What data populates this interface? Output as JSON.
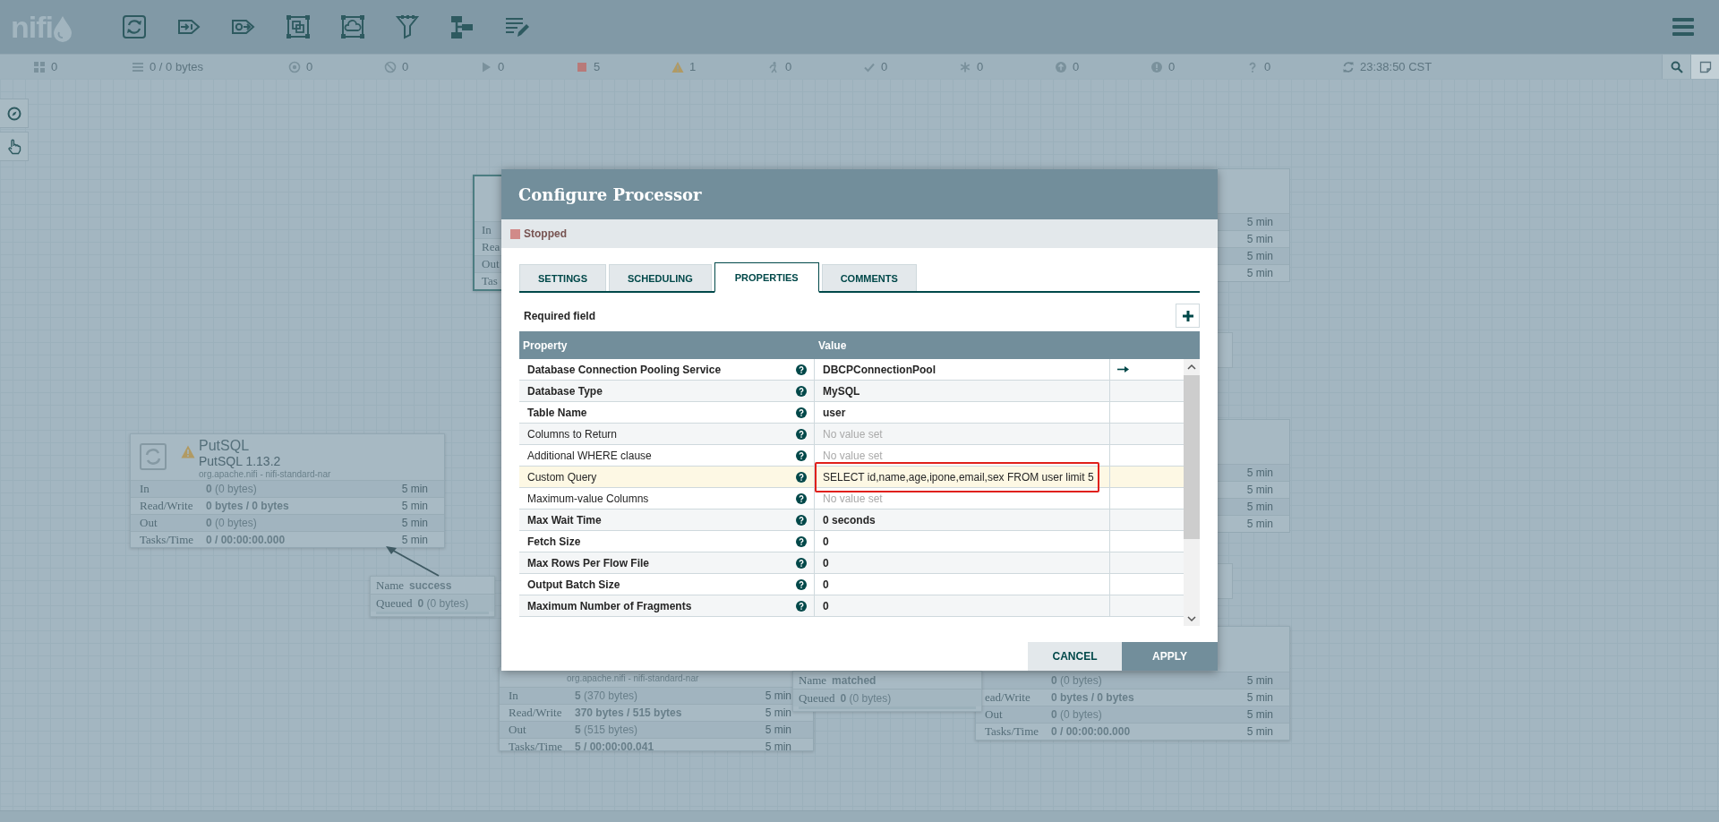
{
  "toolbar": {
    "logo": "nifi"
  },
  "status_bar": {
    "items": [
      {
        "kind": "cluster",
        "count": "0"
      },
      {
        "kind": "queued",
        "count": "0 / 0 bytes"
      },
      {
        "kind": "transmitting",
        "count": "0"
      },
      {
        "kind": "not-transmitting",
        "count": "0"
      },
      {
        "kind": "running",
        "count": "0"
      },
      {
        "kind": "stopped",
        "count": "5"
      },
      {
        "kind": "invalid",
        "count": "1"
      },
      {
        "kind": "disabled",
        "count": "0"
      },
      {
        "kind": "up-to-date",
        "count": "0"
      },
      {
        "kind": "locally-modified",
        "count": "0"
      },
      {
        "kind": "stale",
        "count": "0"
      },
      {
        "kind": "modified-stale",
        "count": "0"
      },
      {
        "kind": "sync-failure",
        "count": "0"
      }
    ],
    "refreshed": "23:38:50 CST"
  },
  "canvas": {
    "processors": [
      {
        "name": "PutSQL",
        "type": "PutSQL 1.13.2",
        "bundle": "org.apache.nifi - nifi-standard-nar",
        "warning": true,
        "selected": false,
        "stats": [
          {
            "label": "In",
            "kind": "count",
            "value": "**0** (0 bytes)",
            "window": "5 min"
          },
          {
            "label": "Read/Write",
            "kind": "total",
            "value": "0 bytes / 0 bytes",
            "window": "5 min"
          },
          {
            "label": "Out",
            "kind": "count",
            "value": "**0** (0 bytes)",
            "window": "5 min"
          },
          {
            "label": "Tasks/Time",
            "kind": "total",
            "value": "0 / 00:00:00.000",
            "window": "5 min"
          }
        ]
      },
      {
        "selected": true,
        "stats": [
          {
            "label": "In"
          },
          {
            "label": "Rea"
          },
          {
            "label": "Out"
          },
          {
            "label": "Tas"
          }
        ]
      },
      {
        "selected": false,
        "stats": [
          {
            "window": "5 min"
          },
          {
            "window": "5 min"
          },
          {
            "window": "5 min"
          },
          {
            "window": "5 min"
          }
        ]
      },
      {
        "selected": false,
        "stats": [
          {
            "window": "5 min"
          },
          {
            "window": "5 min"
          },
          {
            "window": "5 min"
          },
          {
            "window": "5 min"
          }
        ]
      },
      {
        "bundle": "org.apache.nifi - nifi-standard-nar",
        "selected": false,
        "stats": [
          {
            "label": "In",
            "kind": "count",
            "value": "**5** (370 bytes)",
            "window": "5 min"
          },
          {
            "label": "Read/Write",
            "kind": "total",
            "value": "370 bytes / 515 bytes",
            "window": "5 min"
          },
          {
            "label": "Out",
            "kind": "count",
            "value": "**5** (515 bytes)",
            "window": "5 min"
          },
          {
            "label": "Tasks/Time",
            "kind": "total",
            "value": "5 / 00:00:00.041",
            "window": "5 min"
          }
        ]
      },
      {
        "selected": false,
        "stats": [
          {
            "kind": "count",
            "value": "**0** (0 bytes)",
            "window": "5 min"
          },
          {
            "label": "ead/Write",
            "kind": "total",
            "value": "0 bytes / 0 bytes",
            "window": "5 min"
          },
          {
            "label": "Out",
            "kind": "count",
            "value": "**0** (0 bytes)",
            "window": "5 min"
          },
          {
            "label": "Tasks/Time",
            "kind": "total",
            "value": "0 / 00:00:00.000",
            "window": "5 min"
          }
        ]
      }
    ],
    "connections": [
      {
        "name_label": "Name",
        "name": "success",
        "queued_label": "Queued",
        "queued": "**0** (0 bytes)"
      },
      {
        "name_label": "Name",
        "name": "matched",
        "queued_label": "Queued",
        "queued": "**0** (0 bytes)"
      }
    ]
  },
  "dialog": {
    "title": "Configure Processor",
    "state": {
      "kind": "stopped",
      "label": "Stopped"
    },
    "tabs": [
      {
        "label": "SETTINGS",
        "selected": false
      },
      {
        "label": "SCHEDULING",
        "selected": false
      },
      {
        "label": "PROPERTIES",
        "selected": true
      },
      {
        "label": "COMMENTS",
        "selected": false
      }
    ],
    "required_note": "Required field",
    "columns": [
      "Property",
      "Value"
    ],
    "properties": [
      {
        "name": "Database Connection Pooling Service",
        "required": true,
        "value": "DBCPConnectionPool",
        "value_set": true,
        "goto": true,
        "selected": false,
        "highlighted": false
      },
      {
        "name": "Database Type",
        "required": true,
        "value": "MySQL",
        "value_set": true,
        "goto": false,
        "selected": false,
        "highlighted": false
      },
      {
        "name": "Table Name",
        "required": true,
        "value": "user",
        "value_set": true,
        "goto": false,
        "selected": false,
        "highlighted": false
      },
      {
        "name": "Columns to Return",
        "required": false,
        "value": "No value set",
        "value_set": false,
        "goto": false,
        "selected": false,
        "highlighted": false
      },
      {
        "name": "Additional WHERE clause",
        "required": false,
        "value": "No value set",
        "value_set": false,
        "goto": false,
        "selected": false,
        "highlighted": false
      },
      {
        "name": "Custom Query",
        "required": false,
        "value": "SELECT id,name,age,ipone,email,sex FROM user limit 5",
        "value_set": true,
        "goto": false,
        "selected": true,
        "highlighted": true
      },
      {
        "name": "Maximum-value Columns",
        "required": false,
        "value": "No value set",
        "value_set": false,
        "goto": false,
        "selected": false,
        "highlighted": false
      },
      {
        "name": "Max Wait Time",
        "required": true,
        "value": "0 seconds",
        "value_set": true,
        "goto": false,
        "selected": false,
        "highlighted": false
      },
      {
        "name": "Fetch Size",
        "required": true,
        "value": "0",
        "value_set": true,
        "goto": false,
        "selected": false,
        "highlighted": false
      },
      {
        "name": "Max Rows Per Flow File",
        "required": true,
        "value": "0",
        "value_set": true,
        "goto": false,
        "selected": false,
        "highlighted": false
      },
      {
        "name": "Output Batch Size",
        "required": true,
        "value": "0",
        "value_set": true,
        "goto": false,
        "selected": false,
        "highlighted": false
      },
      {
        "name": "Maximum Number of Fragments",
        "required": true,
        "value": "0",
        "value_set": true,
        "goto": false,
        "selected": false,
        "highlighted": false
      }
    ],
    "buttons": [
      {
        "label": "CANCEL",
        "kind": "secondary"
      },
      {
        "label": "APPLY",
        "kind": "primary"
      }
    ]
  }
}
